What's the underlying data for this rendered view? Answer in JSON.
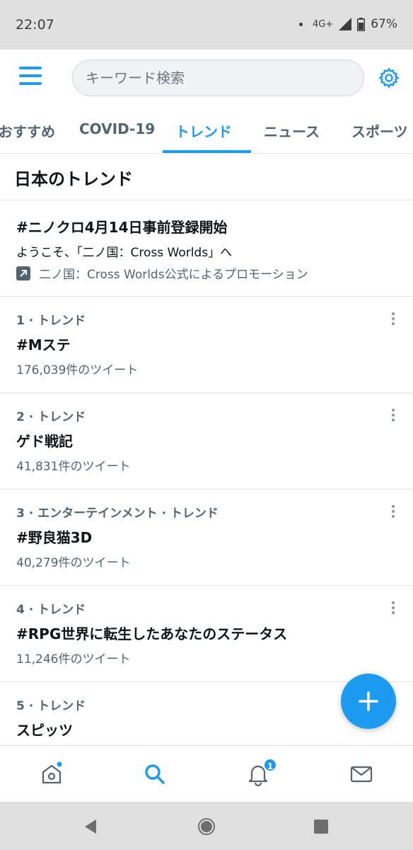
{
  "status_bar": {
    "time": "22:07",
    "network": "4G+",
    "battery": "67%",
    "icons": [
      "notification-dot-icon",
      "signal-icon",
      "battery-icon"
    ]
  },
  "top_bar": {
    "search_placeholder": "キーワード検索",
    "icons": [
      "menu-icon",
      "gear-icon"
    ]
  },
  "tabs": [
    {
      "label": "おすすめ",
      "active": false
    },
    {
      "label": "COVID-19",
      "active": false
    },
    {
      "label": "トレンド",
      "active": true
    },
    {
      "label": "ニュース",
      "active": false
    },
    {
      "label": "スポーツ",
      "active": false
    }
  ],
  "section": {
    "title": "日本のトレンド"
  },
  "promoted": {
    "title": "#ニノクロ4月14日事前登録開始",
    "description": "ようこそ、「二ノ国：Cross Worlds」へ",
    "promoted_by": "二ノ国：Cross Worlds公式によるプロモーション"
  },
  "trends": [
    {
      "meta": "1 · トレンド",
      "name": "#Mステ",
      "count": "176,039件のツイート"
    },
    {
      "meta": "2 · トレンド",
      "name": "ゲド戦記",
      "count": "41,831件のツイート"
    },
    {
      "meta": "3 · エンターテインメント · トレンド",
      "name": "#野良猫3D",
      "count": "40,279件のツイート"
    },
    {
      "meta": "4 · トレンド",
      "name": "#RPG世界に転生したあなたのステータス",
      "count": "11,246件のツイート"
    },
    {
      "meta": "5 · トレンド",
      "name": "スピッツ",
      "count": ""
    }
  ],
  "bottom_nav": {
    "items": [
      "home-icon",
      "search-icon",
      "bell-icon",
      "mail-icon"
    ],
    "notification_count": "1"
  },
  "colors": {
    "accent": "#1d9bf0",
    "text_primary": "#0f1419",
    "text_secondary": "#536471",
    "divider": "#e1e8ed"
  }
}
